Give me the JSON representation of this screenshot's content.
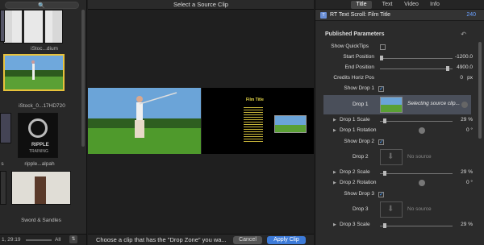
{
  "browser": {
    "clips": [
      {
        "label": "iStoc...dium"
      },
      {
        "label": "iStock_0...17HD720"
      },
      {
        "label": "ripple...alpah"
      },
      {
        "label": "Sword & Sandles"
      }
    ],
    "partial_label_1": "s",
    "status_left": "1, 29:19",
    "zoom_label": "All"
  },
  "viewer": {
    "title": "Select a Source Clip",
    "overlay_title": "Film Title",
    "hint": "Choose a clip that has the \"Drop Zone\" you wa...",
    "cancel": "Cancel",
    "apply": "Apply Clip"
  },
  "inspector": {
    "tabs": [
      "Title",
      "Text",
      "Video",
      "Info"
    ],
    "active_tab": "Title",
    "header_title": "RT Text Scroll: Film Title",
    "header_value": "240",
    "section": "Published Parameters",
    "params": {
      "quicktips": "Show QuickTips",
      "start_pos": "Start Position",
      "start_val": "-1200.0",
      "end_pos": "End Position",
      "end_val": "4900.0",
      "credits": "Credits Horiz Pos",
      "credits_val": "0",
      "credits_unit": "px",
      "show_drop1": "Show Drop 1",
      "drop1": "Drop 1",
      "drop1_status": "Selecting source clip...",
      "drop1_scale": "Drop 1 Scale",
      "drop1_scale_val": "29 %",
      "drop1_rot": "Drop 1 Rotation",
      "drop1_rot_val": "0 °",
      "show_drop2": "Show Drop 2",
      "drop2": "Drop 2",
      "drop2_status": "No source",
      "drop2_scale": "Drop 2 Scale",
      "drop2_scale_val": "29 %",
      "drop2_rot": "Drop 2 Rotation",
      "drop2_rot_val": "0 °",
      "show_drop3": "Show Drop 3",
      "drop3": "Drop 3",
      "drop3_status": "No source",
      "drop3_scale": "Drop 3 Scale",
      "drop3_scale_val": "29 %"
    }
  },
  "check_glyph": "✓",
  "tri_glyph": "▶",
  "colors": {
    "accent": "#3d7bd9",
    "selection": "#e8c23b"
  }
}
